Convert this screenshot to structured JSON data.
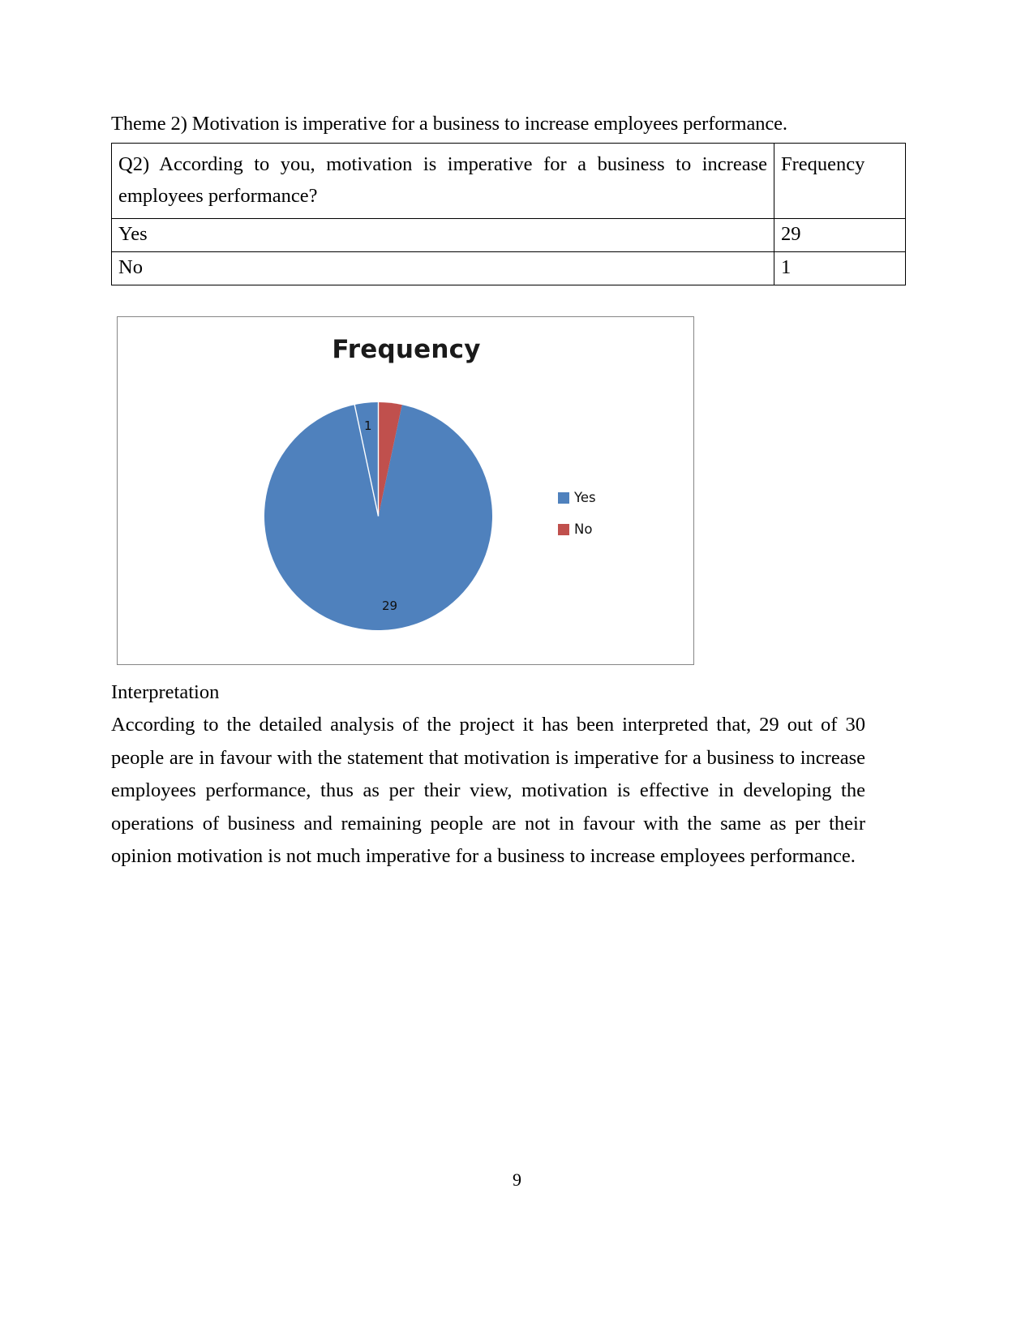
{
  "document": {
    "theme_line": "Theme 2) Motivation is imperative for a business to increase employees performance.",
    "page_number": "9"
  },
  "table": {
    "header": {
      "question": "Q2) According to you, motivation is imperative for a business to increase employees performance?",
      "frequency_label": "Frequency"
    },
    "rows": [
      {
        "label": "Yes",
        "value": "29"
      },
      {
        "label": "No",
        "value": "1"
      }
    ]
  },
  "chart_data": {
    "type": "pie",
    "title": "Frequency",
    "categories": [
      "Yes",
      "No"
    ],
    "values": [
      29,
      1
    ],
    "data_labels": [
      "29",
      "1"
    ],
    "total": 30,
    "legend": {
      "position": "right",
      "entries": [
        {
          "label": "Yes",
          "color": "#4F81BD"
        },
        {
          "label": "No",
          "color": "#C0504D"
        }
      ]
    },
    "colors": [
      "#4F81BD",
      "#C0504D"
    ],
    "start_angle_deg": 0,
    "direction": "counterclockwise",
    "grid": false,
    "xlabel": "",
    "ylabel": ""
  },
  "interpretation": {
    "heading": "Interpretation",
    "body": "According to the detailed analysis of the project it has been interpreted that, 29 out of 30 people are in favour with the statement that motivation is imperative for a business to increase employees performance, thus as per their view, motivation is effective in developing the operations of business and remaining people are not in favour with the same as per their opinion motivation is not much imperative for a business to increase employees performance."
  }
}
